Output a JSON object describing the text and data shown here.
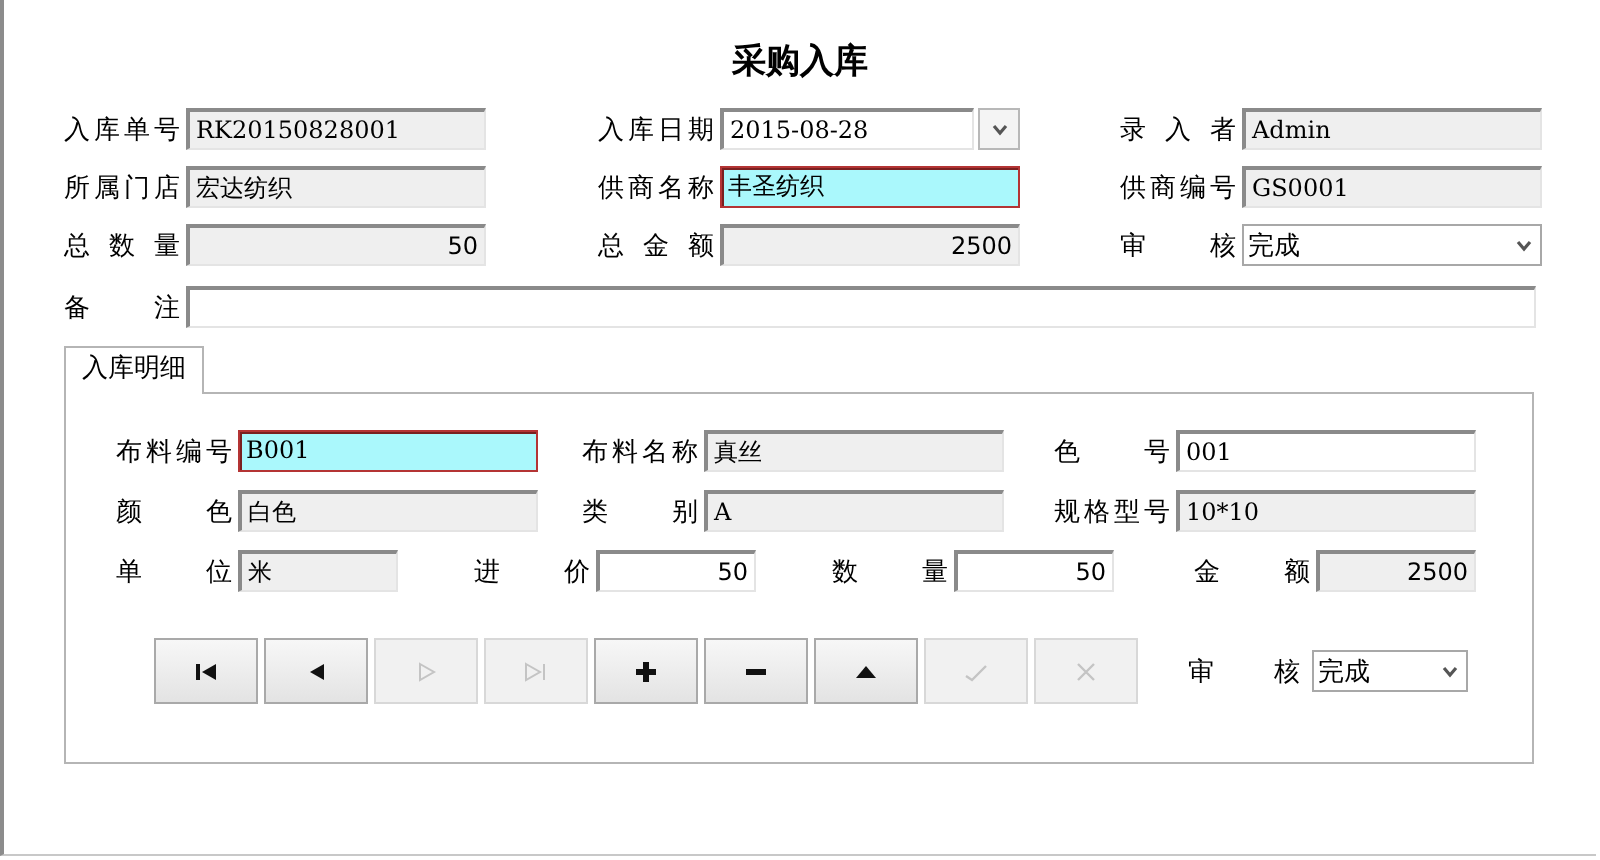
{
  "title": "采购入库",
  "header_rows": [
    [
      {
        "label": "入库单号",
        "value": "RK20150828001",
        "kind": "readonly"
      },
      {
        "label": "入库日期",
        "value": "2015-08-28",
        "kind": "date"
      },
      {
        "label": "录 入 者",
        "value": "Admin",
        "kind": "readonly"
      }
    ],
    [
      {
        "label": "所属门店",
        "value": "宏达纺织",
        "kind": "readonly"
      },
      {
        "label": "供商名称",
        "value": "丰圣纺织",
        "kind": "highlight"
      },
      {
        "label": "供商编号",
        "value": "GS0001",
        "kind": "readonly"
      }
    ],
    [
      {
        "label": "总 数 量",
        "value": "50",
        "kind": "readonly-number"
      },
      {
        "label": "总 金 额",
        "value": "2500",
        "kind": "readonly-number"
      },
      {
        "label": "审 核",
        "value": "完成",
        "kind": "select"
      }
    ]
  ],
  "note": {
    "label": "备 注"
  },
  "tabs": [
    {
      "label": "入库明细",
      "selected": true
    }
  ],
  "detail_rows": [
    [
      {
        "label": "布料编号",
        "value": "B001",
        "kind": "highlight"
      },
      {
        "label": "布料名称",
        "value": "真丝",
        "kind": "readonly"
      },
      {
        "label": "色 号",
        "value": "001",
        "kind": "input"
      }
    ],
    [
      {
        "label": "颜 色",
        "value": "白色",
        "kind": "readonly"
      },
      {
        "label": "类 别",
        "value": "A",
        "kind": "readonly"
      },
      {
        "label": "规格型号",
        "value": "10*10",
        "kind": "readonly"
      }
    ],
    [
      {
        "label": "单 位",
        "value": "米",
        "kind": "readonly"
      },
      {
        "label": "进 价",
        "value": "50",
        "kind": "input-number"
      },
      {
        "label": "数 量",
        "value": "50",
        "kind": "input-number"
      },
      {
        "label": "金 额",
        "value": "2500",
        "kind": "readonly-number"
      }
    ]
  ],
  "nav_buttons": [
    {
      "kind": "first",
      "disabled": false
    },
    {
      "kind": "prev",
      "disabled": false
    },
    {
      "kind": "next",
      "disabled": true
    },
    {
      "kind": "last",
      "disabled": true
    },
    {
      "kind": "add",
      "disabled": false
    },
    {
      "kind": "remove",
      "disabled": false
    },
    {
      "kind": "up",
      "disabled": false
    },
    {
      "kind": "save",
      "disabled": true
    },
    {
      "kind": "cancel",
      "disabled": true
    }
  ],
  "detail_audit": {
    "label": "审 核",
    "value": "完成"
  }
}
